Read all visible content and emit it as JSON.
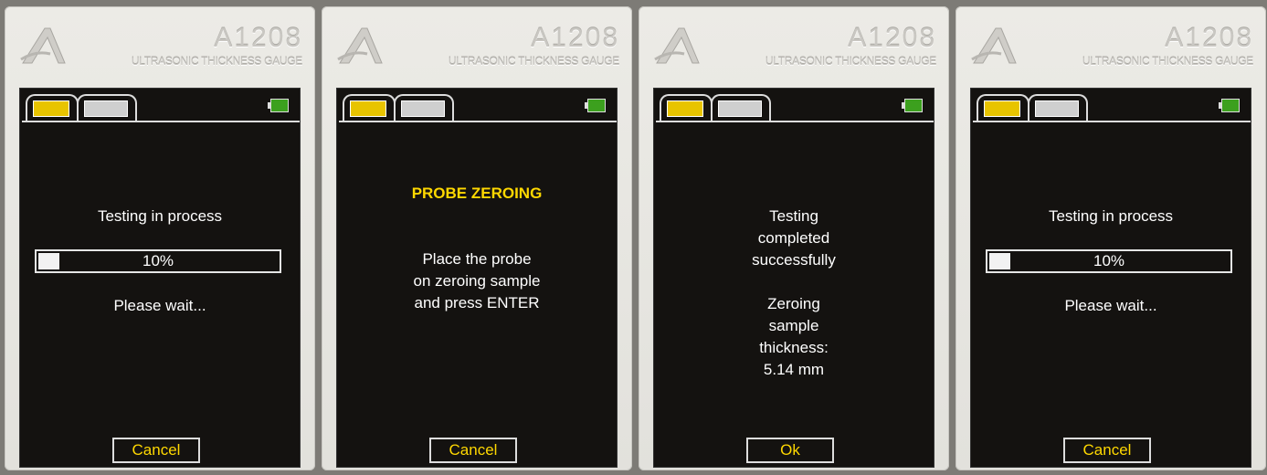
{
  "device": {
    "model": "A1208",
    "subtitle": "ULTRASONIC THICKNESS GAUGE",
    "logo_icon": "acoustic-a-logo"
  },
  "screens": [
    {
      "line1": "Testing in process",
      "progress_text": "10%",
      "progress_fraction": 0.1,
      "line2": "Please wait...",
      "button": "Cancel"
    },
    {
      "title": "PROBE ZEROING",
      "lines": [
        "Place the probe",
        "on zeroing sample",
        "and press ENTER"
      ],
      "button": "Cancel"
    },
    {
      "lines": [
        "Testing",
        "completed",
        "successfully"
      ],
      "lines2": [
        "Zeroing",
        "sample",
        "thickness:",
        "5.14 mm"
      ],
      "button": "Ok"
    },
    {
      "line1": "Testing in process",
      "progress_text": "10%",
      "progress_fraction": 0.1,
      "line2": "Please wait...",
      "button": "Cancel"
    }
  ],
  "tab_icons": [
    "thickness-measure-icon",
    "digital-readout-icon"
  ],
  "battery_icon": "battery-full-icon",
  "colors": {
    "accent": "#ffd800",
    "screen_bg": "#141210",
    "battery": "#3ca01e"
  }
}
